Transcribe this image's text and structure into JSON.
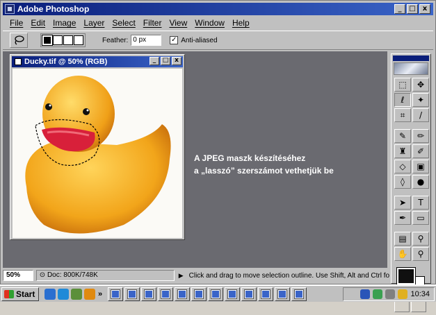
{
  "app": {
    "title": "Adobe Photoshop"
  },
  "window_buttons": {
    "minimize": "_",
    "maximize": "□",
    "close": "x"
  },
  "menu": [
    "File",
    "Edit",
    "Image",
    "Layer",
    "Select",
    "Filter",
    "View",
    "Window",
    "Help"
  ],
  "options": {
    "feather_label": "Feather:",
    "feather_value": "0 px",
    "anti_aliased_label": "Anti-aliased",
    "anti_aliased_checked": true
  },
  "document": {
    "title": "Ducky.tif @ 50% (RGB)"
  },
  "caption": {
    "line1": "A JPEG maszk készítéséhez",
    "line2": "a „lasszó” szerszámot vethetjük be"
  },
  "status": {
    "zoom": "50%",
    "doc_size": "Doc: 800K/748K",
    "hint": "Click and drag to move selection outline. Use Shift, Alt and Ctrl for"
  },
  "toolbox": {
    "tools": [
      "marquee",
      "move",
      "lasso",
      "magic-wand",
      "crop",
      "eyedropper-slice",
      "brush",
      "pencil",
      "stamp",
      "history-brush",
      "eraser",
      "gradient",
      "blur",
      "dodge",
      "path-select",
      "type",
      "pen",
      "shape",
      "notes",
      "eyedropper",
      "hand",
      "zoom"
    ],
    "active_tool": "lasso",
    "foreground_color": "#101010",
    "background_color": "#ffffff"
  },
  "taskbar": {
    "start_label": "Start",
    "clock": "10:34",
    "chevron": "»"
  }
}
